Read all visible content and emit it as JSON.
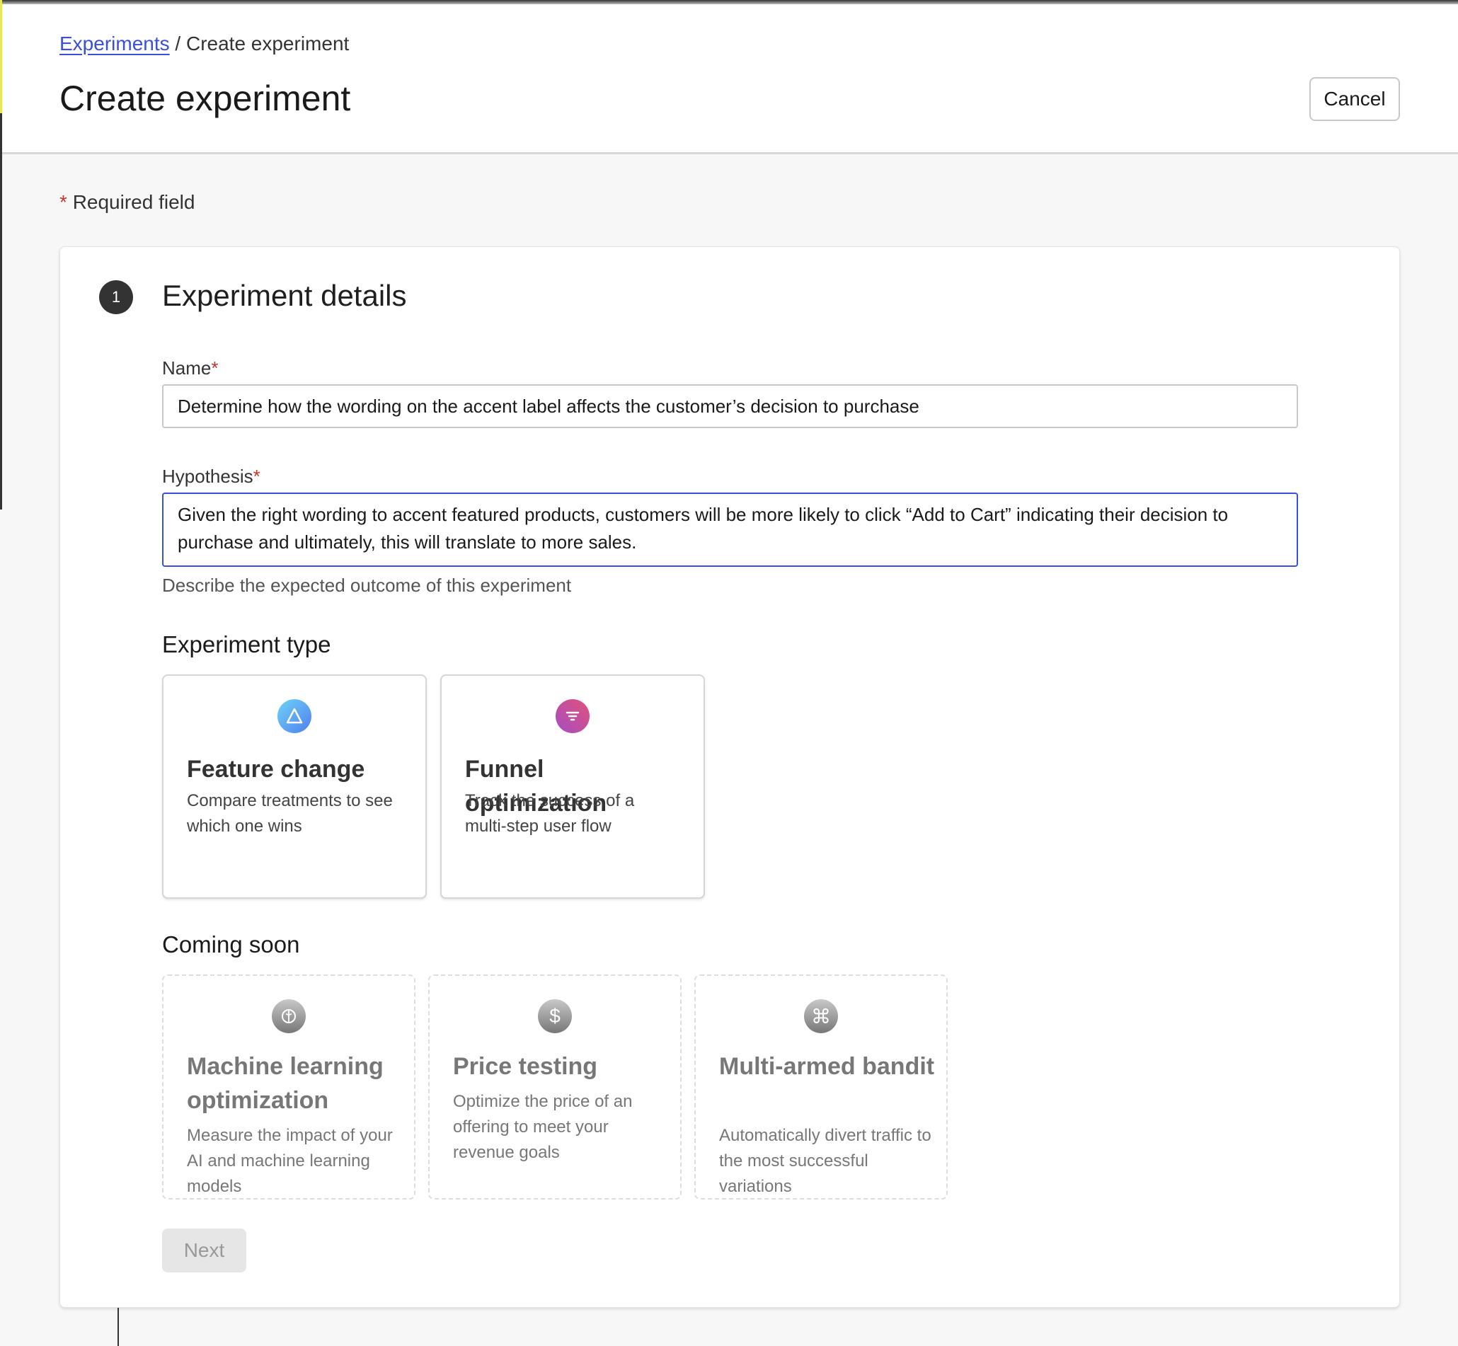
{
  "breadcrumb": {
    "parent": "Experiments",
    "separator": "/",
    "current": "Create experiment"
  },
  "header": {
    "title": "Create experiment",
    "cancel_label": "Cancel"
  },
  "required_note": {
    "asterisk": "*",
    "text": "Required field"
  },
  "section": {
    "step": "1",
    "title": "Experiment details"
  },
  "form": {
    "name": {
      "label": "Name",
      "asterisk": "*",
      "value": "Determine how the wording on the accent label affects the customer’s decision to purchase"
    },
    "hypothesis": {
      "label": "Hypothesis",
      "asterisk": "*",
      "value": "Given the right wording to accent featured products, customers will be more likely to click “Add to Cart” indicating their decision to purchase and ultimately, this will translate to more sales.",
      "help": "Describe the expected outcome of this experiment"
    }
  },
  "experiment_type": {
    "heading": "Experiment type",
    "options": [
      {
        "title": "Feature change",
        "description": "Compare treatments to see which one wins",
        "icon": "triangle-icon",
        "color": "#5aa8f0"
      },
      {
        "title": "Funnel optimization",
        "description": "Track the success of a multi-step user flow",
        "icon": "funnel-icon",
        "color": "#c94aa8"
      }
    ]
  },
  "coming_soon": {
    "heading": "Coming soon",
    "options": [
      {
        "title": "Machine learning optimization",
        "description": "Measure the impact of your AI and machine learning models",
        "icon": "brain-icon"
      },
      {
        "title": "Price testing",
        "description": "Optimize the price of an offering to meet your revenue goals",
        "icon": "dollar-icon"
      },
      {
        "title": "Multi-armed bandit",
        "description": "Automatically divert traffic to the most successful variations",
        "icon": "bandit-icon"
      }
    ]
  },
  "footer": {
    "next_label": "Next"
  }
}
